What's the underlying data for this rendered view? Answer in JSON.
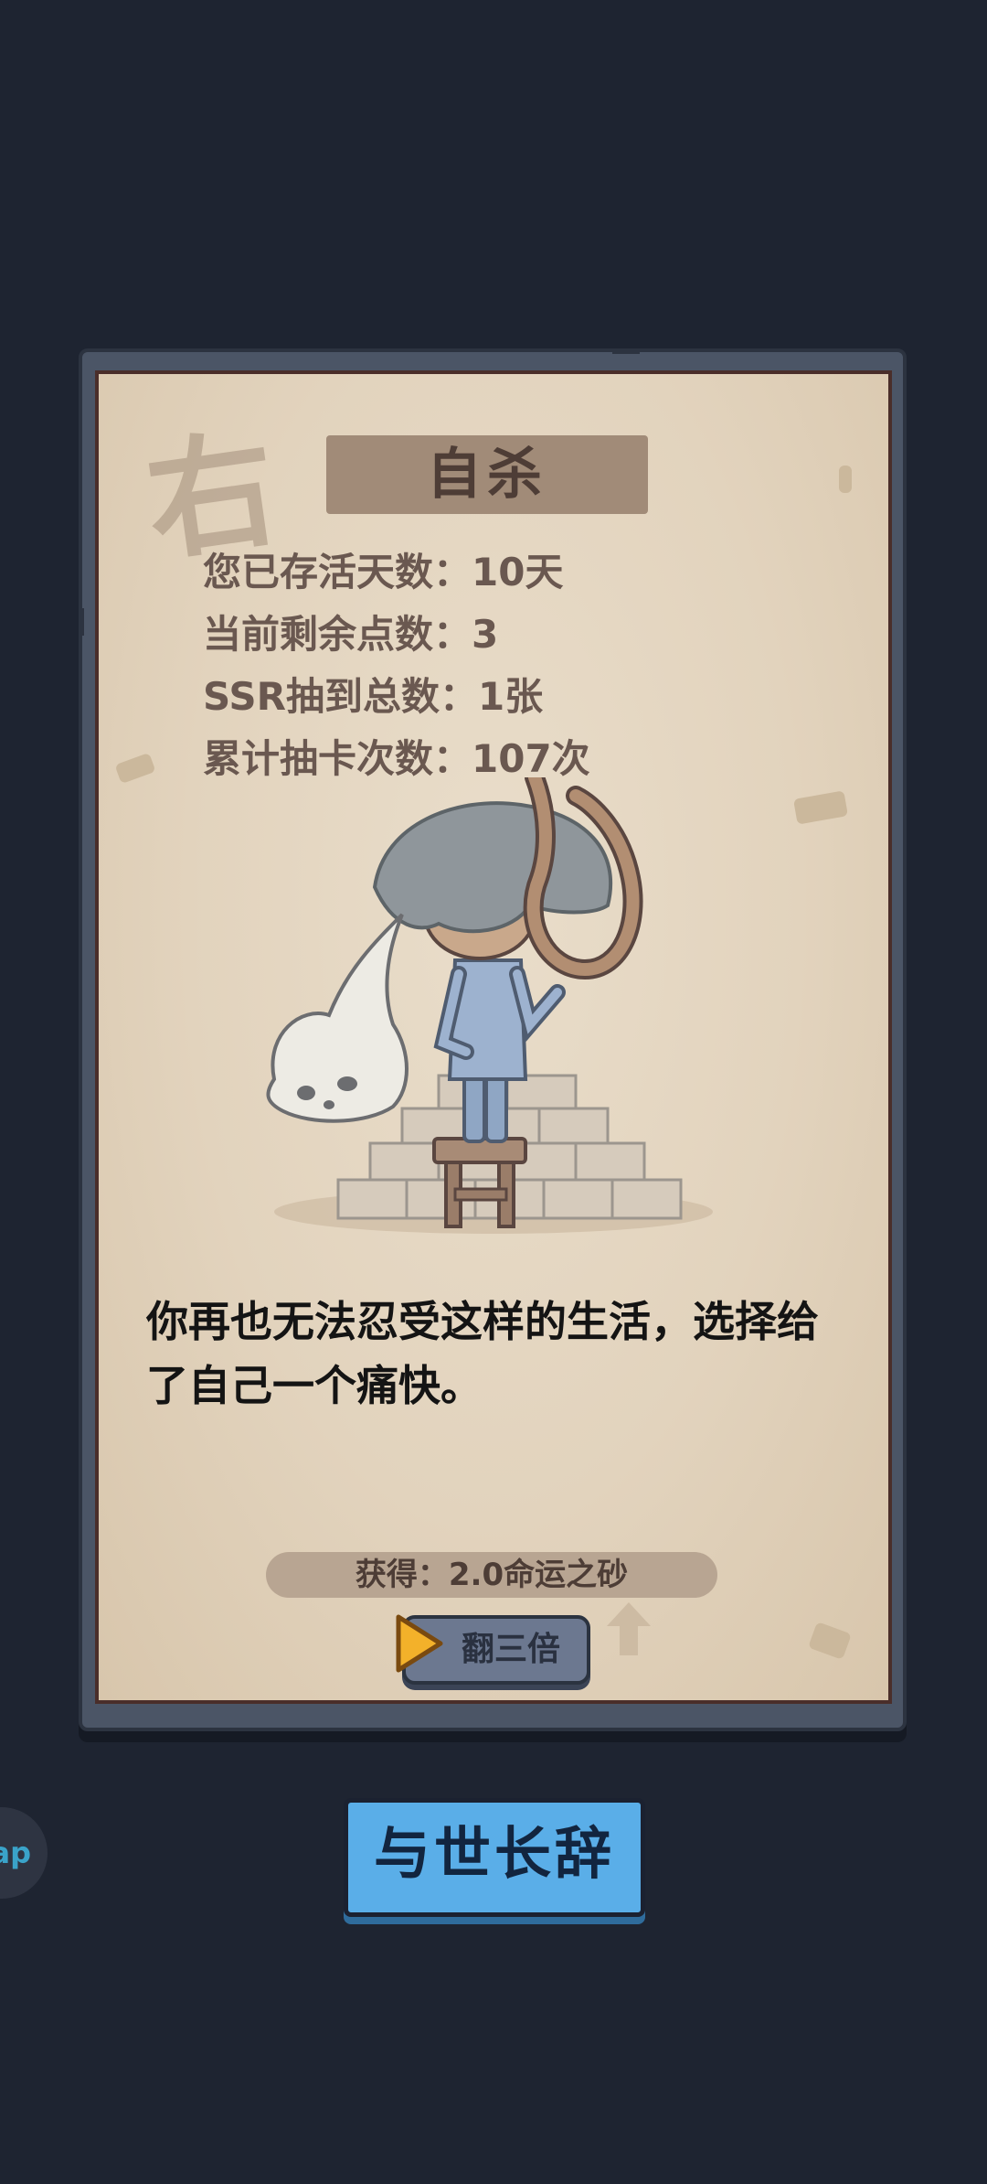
{
  "dialog": {
    "title": "自杀",
    "decor_char": "右"
  },
  "stats": [
    "您已存活天数：10天",
    "当前剩余点数：3",
    "SSR抽到总数：1张",
    "累计抽卡次数：107次"
  ],
  "narrative": "你再也无法忍受这样的生活，选择给了自己一个痛快。",
  "reward": {
    "label": "获得：2.0命运之砂"
  },
  "triple_button": {
    "label": "翻三倍",
    "icon": "play-icon"
  },
  "farewell_button": {
    "label": "与世长辞"
  },
  "side_bubble": {
    "label": "ap"
  },
  "colors": {
    "background": "#1e2431",
    "paper": "#e2d3bd",
    "frame": "#4b5566",
    "farewell_button": "#5aaee8",
    "play_icon": "#f3b12a"
  }
}
